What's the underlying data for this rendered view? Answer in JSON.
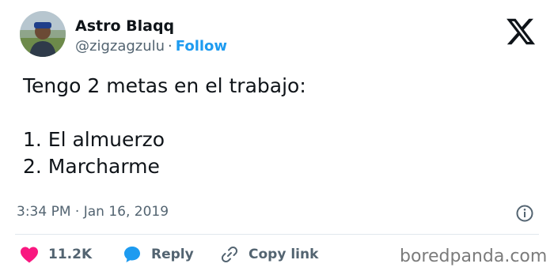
{
  "author": {
    "display_name": "Astro Blaqq",
    "handle": "@zigzagzulu",
    "follow_label": "Follow",
    "separator": "·"
  },
  "tweet": {
    "lines": [
      "Tengo 2 metas en el trabajo:",
      "",
      "1. El almuerzo",
      "2. Marcharme"
    ],
    "timestamp": "3:34 PM · Jan 16, 2019"
  },
  "actions": {
    "like_count": "11.2K",
    "reply_label": "Reply",
    "copy_link_label": "Copy link"
  },
  "watermark": {
    "text": "boredpanda.com"
  },
  "colors": {
    "accent": "#1d9bf0",
    "like": "#f91880",
    "muted": "#536471"
  },
  "icons": {
    "brand": "x-logo-icon",
    "info": "info-icon",
    "like": "heart-icon",
    "reply": "speech-bubble-icon",
    "copy": "link-icon"
  }
}
